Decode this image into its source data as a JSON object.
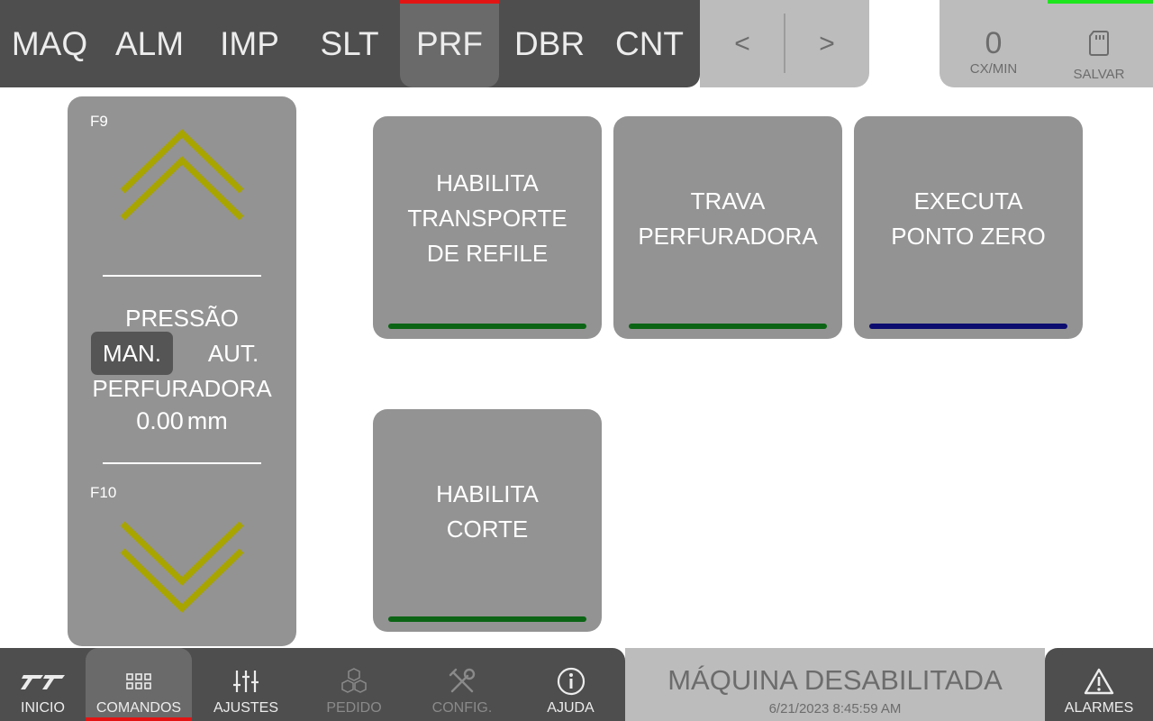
{
  "top_tabs": [
    {
      "label": "MAQ",
      "active": false
    },
    {
      "label": "ALM",
      "active": false
    },
    {
      "label": "IMP",
      "active": false
    },
    {
      "label": "SLT",
      "active": false
    },
    {
      "label": "PRF",
      "active": true
    },
    {
      "label": "DBR",
      "active": false
    },
    {
      "label": "CNT",
      "active": false
    }
  ],
  "pager": {
    "prev_label": "<",
    "next_label": ">"
  },
  "stats": {
    "rate_value": "0",
    "rate_unit": "CX/MIN",
    "save_label": "SALVAR"
  },
  "pressure_panel": {
    "up_key": "F9",
    "down_key": "F10",
    "title_line1": "PRESSÃO",
    "mode_manual": "MAN.",
    "mode_auto": "AUT.",
    "active_mode": "manual",
    "title_line2": "PERFURADORA",
    "value": "0.00",
    "unit": "mm"
  },
  "commands": [
    {
      "label": "HABILITA\nTRANSPORTE\nDE REFILE",
      "indicator_color": "#0b6414"
    },
    {
      "label": "TRAVA\nPERFURADORA",
      "indicator_color": "#0b6414"
    },
    {
      "label": "EXECUTA\nPONTO ZERO",
      "indicator_color": "#0d0d70"
    },
    {
      "label": "HABILITA\nCORTE",
      "indicator_color": "#0b6414"
    }
  ],
  "bottom_nav": [
    {
      "label": "INICIO",
      "icon": "logo-icon",
      "active": false,
      "enabled": true
    },
    {
      "label": "COMANDOS",
      "icon": "grid-icon",
      "active": true,
      "enabled": true
    },
    {
      "label": "AJUSTES",
      "icon": "sliders-icon",
      "active": false,
      "enabled": true
    },
    {
      "label": "PEDIDO",
      "icon": "boxes-icon",
      "active": false,
      "enabled": false
    },
    {
      "label": "CONFIG.",
      "icon": "tools-icon",
      "active": false,
      "enabled": false
    },
    {
      "label": "AJUDA",
      "icon": "info-icon",
      "active": false,
      "enabled": true
    }
  ],
  "machine_status": {
    "state": "MÁQUINA DESABILITADA",
    "timestamp": "6/21/2023 8:45:59 AM"
  },
  "alarms": {
    "label": "ALARMES",
    "icon": "warning-icon"
  },
  "colors": {
    "dark_bar": "#4e4e4e",
    "light_bar": "#bcbcbc",
    "panel": "#939393",
    "active_accent": "#e31414",
    "running_indicator": "#1ee61e",
    "chevron": "#a8a400"
  }
}
